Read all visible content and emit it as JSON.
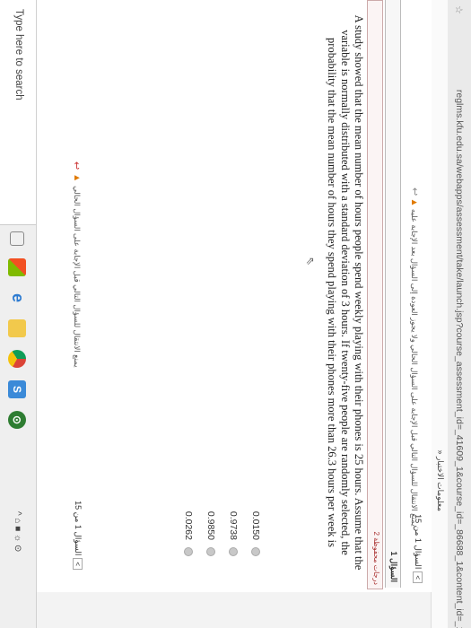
{
  "browser": {
    "star_icon": "☆",
    "url": "reglms.kfu.edu.sa/webapps/assessment/take/launch.jsp?course_assessment_id=_41609_1&course_id=_86688_1&content_id=_1727970_1&"
  },
  "info_strip": {
    "text": "» معلومات الاختبار"
  },
  "top_nav": {
    "pager_label": "السؤال 1 من 15",
    "pager_box": "<",
    "status_note": "يمنع الانتقال للسؤال التالي قبل الإجابة على السؤال الحالي ولا يجوز العودة إلى السؤال بعد الإجابة عليه"
  },
  "question_header": {
    "number_label": "السؤال 1"
  },
  "answer_box": {
    "saved_label": "2 درجات   محفوظة"
  },
  "question": {
    "text": "A study showed that the mean number of hours people spend weekly playing with their phones is 25 hours. Assume that the variable is normally distributed with a standard deviation of 3 hours. If twenty-five people are randomly selected, the probability that the mean number of hours they spend playing with their phones more than 26.3 hours per week is"
  },
  "options": [
    {
      "label": "0.0150"
    },
    {
      "label": "0.9738"
    },
    {
      "label": "0.9850"
    },
    {
      "label": "0.0262"
    }
  ],
  "footer": {
    "pager_label": "السؤال 1 من 15",
    "pager_box": "<",
    "note": "يمنع الانتقال للسؤال التالي قبل الإجابة على السؤال الحالي"
  },
  "taskbar": {
    "search_placeholder": "Type here to search",
    "tray_text": "^ ⌂ ■ ☼ ⊙"
  },
  "colors": {
    "warning": "#e07a00",
    "chrome_icon": "#3b8ad8",
    "edge_icon": "#2d7bd1"
  }
}
